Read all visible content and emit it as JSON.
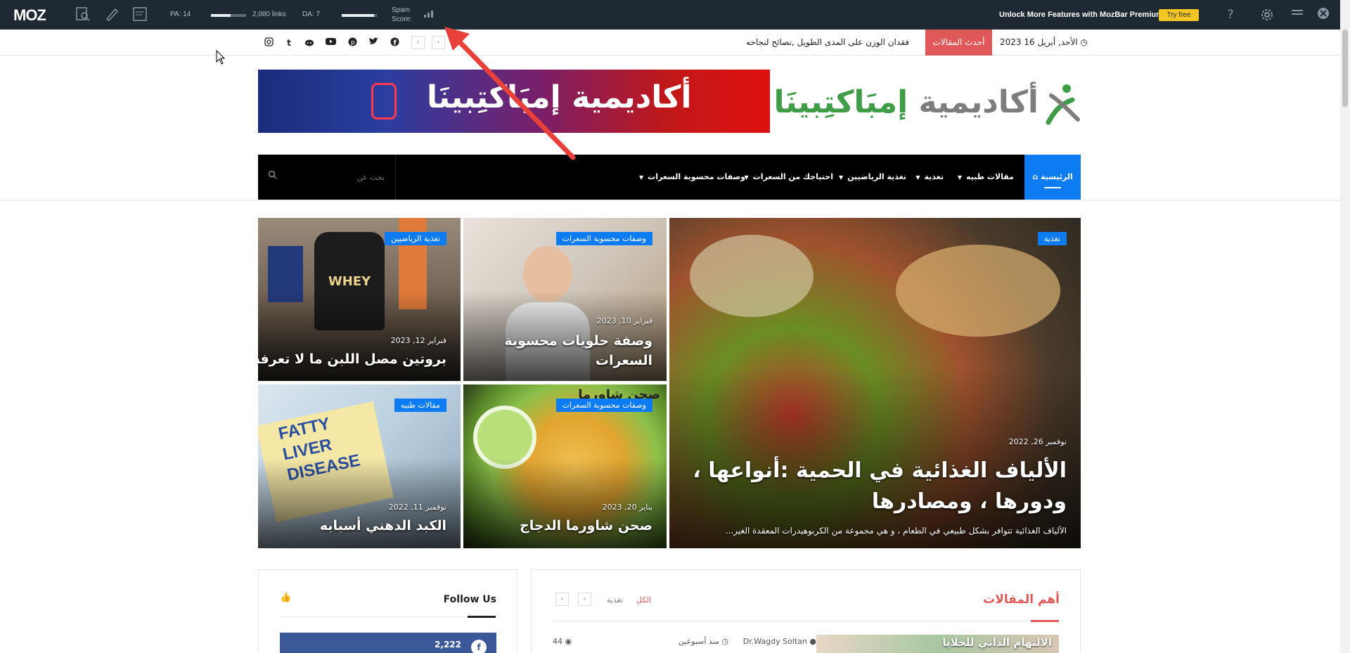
{
  "mozbar": {
    "logo": "MOZ",
    "pa_label": "PA: 14",
    "pa_level": 0.55,
    "links": "2,080 links",
    "da_label": "DA: 7",
    "da_level": 0.92,
    "spam_label_1": "Spam",
    "spam_label_2": "Score:",
    "promo": "Unlock More Features with MozBar Premium",
    "try_free": "Try free",
    "help": "?",
    "accent": "#f3c623",
    "icons": [
      "page-analysis-icon",
      "highlighter-icon",
      "serp-overlay-icon",
      "keyword-difficulty-icon",
      "spam-score-bars-icon",
      "help-icon",
      "settings-gear-icon",
      "hamburger-menu-icon",
      "close-icon"
    ]
  },
  "topstrip": {
    "social_icons": [
      "instagram-icon",
      "tumblr-icon",
      "reddit-icon",
      "youtube-icon",
      "pinterest-icon",
      "twitter-icon",
      "facebook-icon"
    ],
    "ticker_text": "فقدان الوزن على المدى الطويل ,نصائح لنجاحه",
    "latest_label": "أحدث المقالات",
    "latest_color": "#e05959",
    "date": "الأحد, أبريل 16 2023"
  },
  "banner": {
    "text": "أكاديمية إمبَاكتِبينَا"
  },
  "logo": {
    "part1": "أكاديمية ",
    "part2": "إمبَاكتِبينَا"
  },
  "nav": {
    "home": "الرئيسية",
    "items": [
      "مقالات طبيه",
      "تغذية",
      "تغذية الرياضيين",
      "احتياجك من السعرات",
      "وصفات محسوبة السعرات"
    ],
    "search_placeholder": "بحث عن",
    "accent": "#0d7cf2"
  },
  "tiles": [
    {
      "category": "تغذية",
      "date": "نوفمبر 26, 2022",
      "title": "الألياف الغذائية في الحمية :أنواعها ، ودورها ، ومصادرها",
      "excerpt": "الألياف الغذائية تتوافر بشكل طبيعي في الطعام ، و هي مجموعة من الكربوهيدرات المعقدة الغير..."
    },
    {
      "category": "وصفات محسوبة السعرات",
      "date": "فبراير 10, 2023",
      "title": "وصفة حلويات محسوبة السعرات"
    },
    {
      "category": "تغذية الرياضيين",
      "date": "فبراير 12, 2023",
      "title": "بروتين مصل اللبن ما لا تعرفه",
      "img_text": "WHEY"
    },
    {
      "category": "وصفات محسوبة السعرات",
      "date": "يناير 20, 2023",
      "title": "صحن شاورما الدجاج",
      "img_text": "صحن شاورما"
    },
    {
      "category": "مقالات طبيه",
      "date": "نوفمبر 11, 2022",
      "title": "الكبد الدهني أسبابه",
      "img_text_1": "FATTY",
      "img_text_2": "LIVER",
      "img_text_3": "DISEASE"
    }
  ],
  "follow": {
    "title": "Follow Us",
    "fb_count": "2,222"
  },
  "important": {
    "title": "أهم المقالات",
    "tab_all": "الكل",
    "tab_nutrition": "تغذية",
    "thumb_text": "الالتهام الذاتي للخلايا",
    "author": "Dr.Wagdy Soltan",
    "time": "منذ أسبوعين",
    "views": "44"
  }
}
